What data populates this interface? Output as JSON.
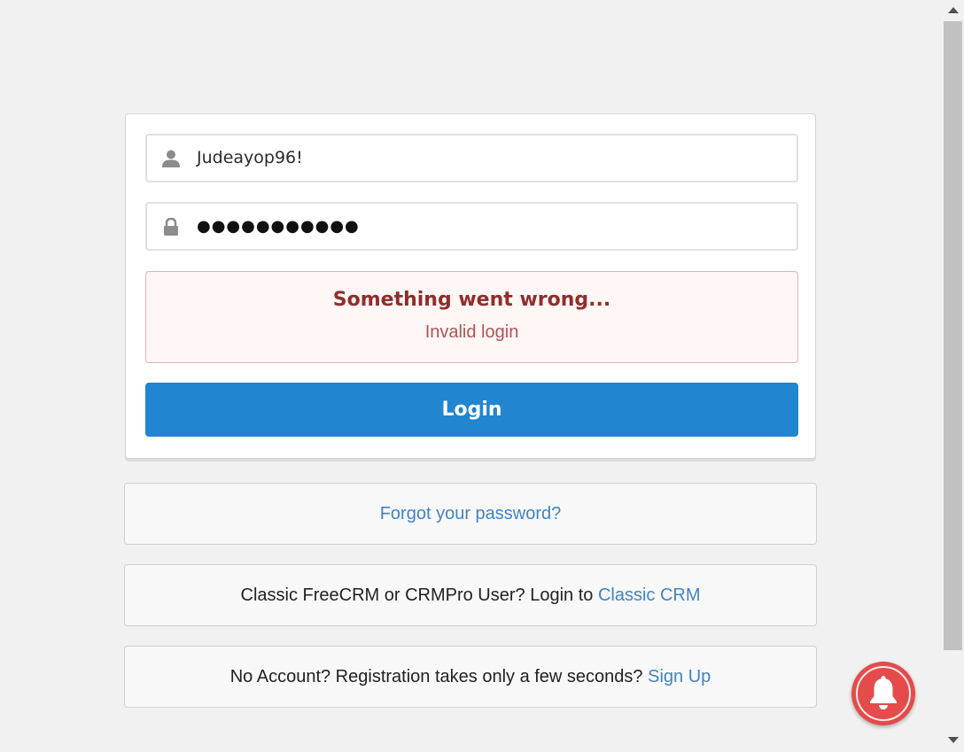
{
  "login_form": {
    "username_value": "Judeayop96!",
    "password_value": "●●●●●●●●●●●",
    "error_title": "Something went wrong...",
    "error_message": "Invalid login",
    "login_button_label": "Login"
  },
  "links": {
    "forgot_password": "Forgot your password?",
    "classic_prefix": "Classic FreeCRM or CRMPro User? Login to ",
    "classic_link": "Classic CRM",
    "signup_prefix": "No Account? Registration takes only a few seconds? ",
    "signup_link": "Sign Up"
  },
  "icons": {
    "username": "user-icon",
    "password": "lock-icon",
    "notification": "bell-icon"
  },
  "colors": {
    "primary_button": "#2185d0",
    "error_background": "#fff6f6",
    "error_title": "#912d2b",
    "link": "#4183c4",
    "notification_button": "#e54b4b"
  }
}
